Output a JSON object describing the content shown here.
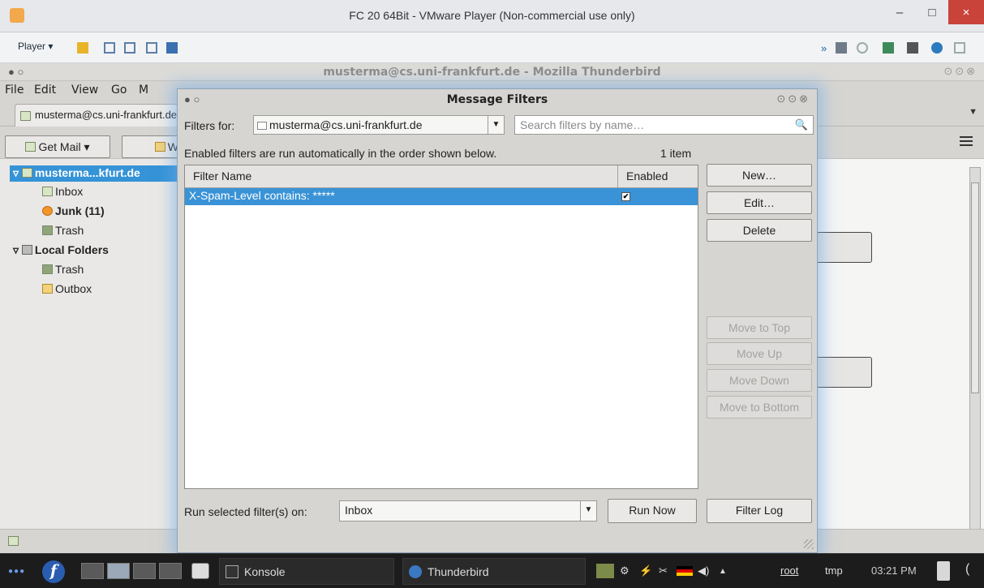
{
  "vmware": {
    "window_title": "FC 20 64Bit - VMware Player (Non-commercial use only)",
    "player_menu": "Player ▾",
    "controls": {
      "minimize": "–",
      "maximize": "□",
      "close": "×"
    }
  },
  "thunderbird": {
    "window_title": "musterma@cs.uni-frankfurt.de - Mozilla Thunderbird",
    "menu": [
      "File",
      "Edit",
      "View",
      "Go",
      "M"
    ],
    "tab_label": "musterma@cs.uni-frankfurt.de",
    "toolbar": {
      "get_mail": "Get Mail ▾",
      "write": "Write"
    },
    "folders": {
      "account": "musterma...kfurt.de",
      "inbox": "Inbox",
      "junk": "Junk (11)",
      "trash": "Trash",
      "local_folders": "Local Folders",
      "local_trash": "Trash",
      "outbox": "Outbox"
    }
  },
  "dialog": {
    "title": "Message Filters",
    "filters_for_label": "Filters for:",
    "filters_for_value": "musterma@cs.uni-frankfurt.de",
    "search_placeholder": "Search filters by name…",
    "info_text": "Enabled filters are run automatically in the order shown below.",
    "item_count": "1 item",
    "columns": {
      "name": "Filter Name",
      "enabled": "Enabled"
    },
    "filters": [
      {
        "name": "X-Spam-Level contains: *****",
        "enabled": true
      }
    ],
    "buttons": {
      "new": "New…",
      "edit": "Edit…",
      "delete": "Delete",
      "move_top": "Move to Top",
      "move_up": "Move Up",
      "move_down": "Move Down",
      "move_bottom": "Move to Bottom",
      "run_now": "Run Now",
      "filter_log": "Filter Log"
    },
    "run_on_label": "Run selected filter(s) on:",
    "run_on_value": "Inbox"
  },
  "taskbar": {
    "tasks": {
      "konsole": "Konsole",
      "thunderbird": "Thunderbird"
    },
    "tray_user": "root",
    "tray_dir": "tmp",
    "clock": "03:21 PM"
  }
}
